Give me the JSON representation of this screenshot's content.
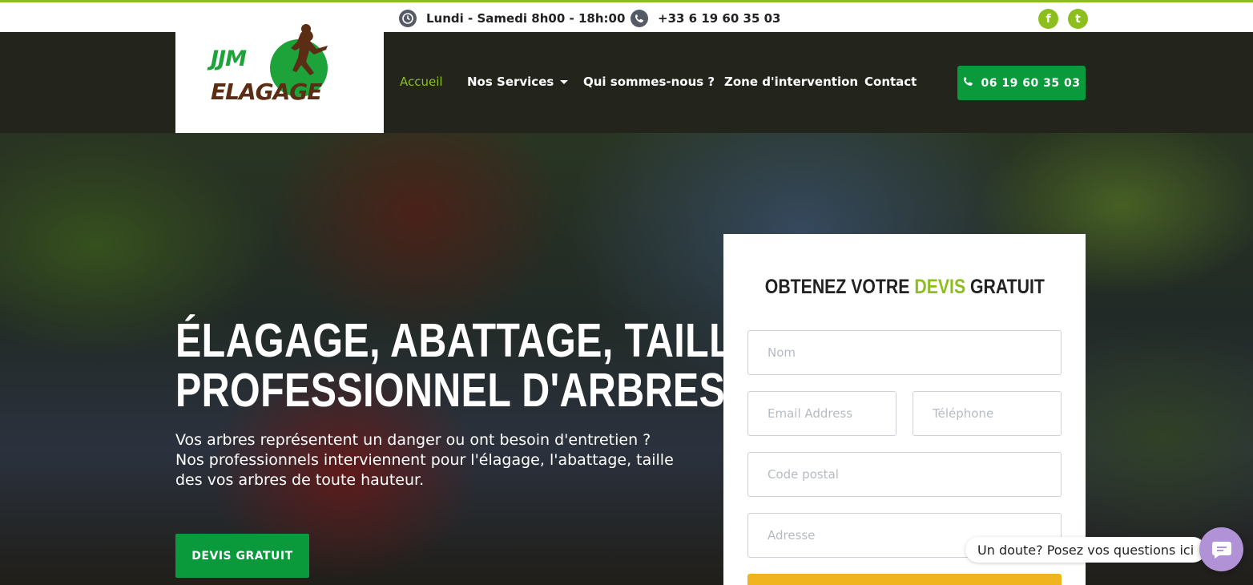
{
  "topbar": {
    "hours": "Lundi - Samedi 8h00 - 18h:00",
    "phone": "+33 6 19 60 35 03",
    "social": [
      {
        "name": "facebook-icon",
        "glyph": "f"
      },
      {
        "name": "tumblr-icon",
        "glyph": "t"
      }
    ]
  },
  "logo": {
    "top": "JJM",
    "bottom": "ELAGAGE"
  },
  "nav": {
    "items": [
      {
        "label": "Accueil"
      },
      {
        "label": "Nos Services"
      },
      {
        "label": "Qui sommes-nous ?"
      },
      {
        "label": "Zone d'intervention"
      },
      {
        "label": "Contact"
      }
    ],
    "phone_button": "06 19 60 35 03"
  },
  "hero": {
    "title_line1": "ÉLAGAGE, ABATTAGE, TAILLE",
    "title_line2": "PROFESSIONNEL D'ARBRES",
    "text": "Vos arbres représentent un danger ou ont besoin d'entretien ? Nos professionnels interviennent pour l'élagage, l'abattage, taille des vos arbres de toute hauteur.",
    "button": "DEVIS GRATUIT"
  },
  "form": {
    "title_before": "OBTENEZ VOTRE ",
    "title_accent": "DEVIS",
    "title_after": " GRATUIT",
    "placeholders": {
      "nom": "Nom",
      "email": "Email Address",
      "telephone": "Téléphone",
      "code_postal": "Code postal",
      "adresse": "Adresse"
    }
  },
  "chat": {
    "bubble": "Un doute? Posez vos questions ici"
  },
  "colors": {
    "accent_green": "#8cbf1e",
    "button_green": "#0a9a3c",
    "nav_bg": "#23241c",
    "submit_yellow": "#f0b51e",
    "chat_purple": "#b292d6"
  }
}
